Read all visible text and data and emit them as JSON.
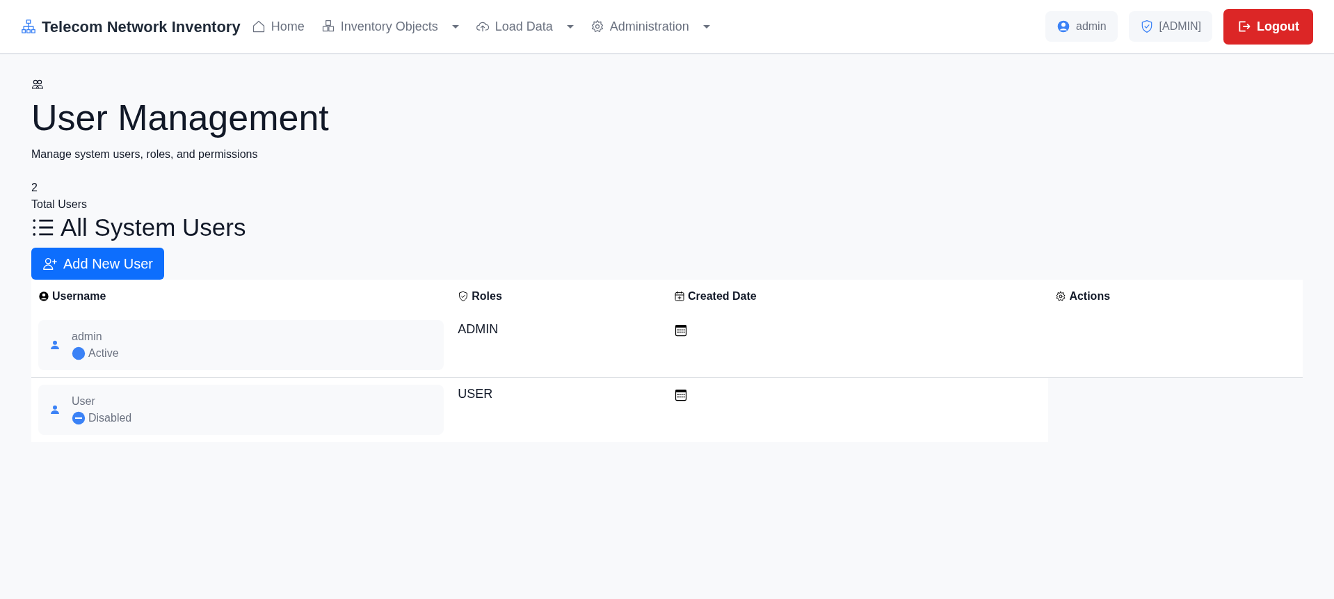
{
  "navbar": {
    "brand": "Telecom Network Inventory",
    "items": [
      {
        "label": "Home",
        "kind": "link"
      },
      {
        "label": "Inventory Objects",
        "kind": "dropdown"
      },
      {
        "label": "Load Data",
        "kind": "dropdown"
      },
      {
        "label": "Administration",
        "kind": "dropdown"
      }
    ],
    "user": "admin",
    "role": "[ADMIN]",
    "logout": "Logout"
  },
  "header": {
    "title": "User Management",
    "subtitle": "Manage system users, roles, and permissions"
  },
  "stats": {
    "count": "2",
    "label": "Total Users"
  },
  "section_title": "All System Users",
  "add_button": "Add New User",
  "table": {
    "columns": [
      "Username",
      "Roles",
      "Created Date",
      "Actions"
    ],
    "rows": [
      {
        "username": "admin",
        "status": "Active",
        "active": true,
        "role": "ADMIN"
      },
      {
        "username": "User",
        "status": "Disabled",
        "active": false,
        "role": "USER"
      }
    ]
  }
}
